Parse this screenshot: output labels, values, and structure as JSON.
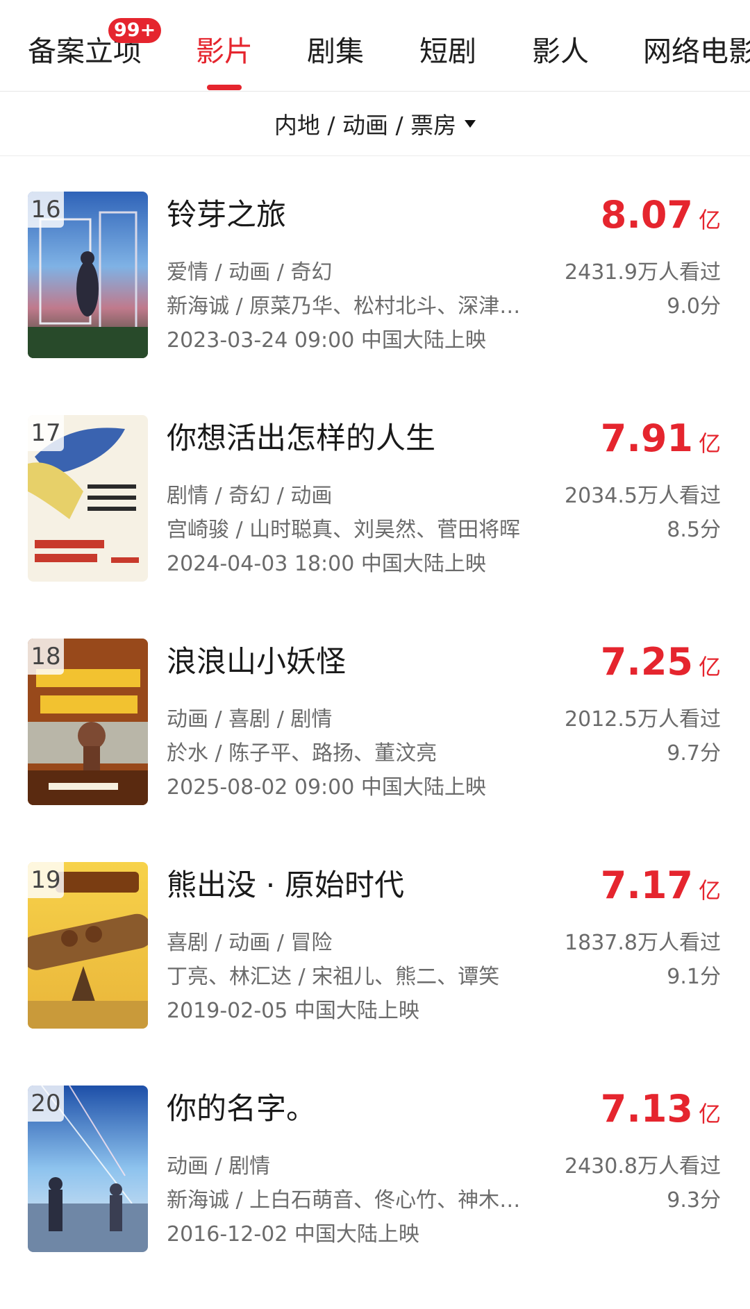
{
  "colors": {
    "accent": "#e5252e",
    "text_primary": "#1a1a1a",
    "text_secondary": "#6b6b6b"
  },
  "tabs": [
    {
      "label": "备案立项",
      "badge": "99+",
      "active": false
    },
    {
      "label": "影片",
      "active": true
    },
    {
      "label": "剧集",
      "active": false
    },
    {
      "label": "短剧",
      "active": false
    },
    {
      "label": "影人",
      "active": false
    },
    {
      "label": "网络电影",
      "active": false
    }
  ],
  "filter": {
    "label": "内地 / 动画 / 票房",
    "icon": "caret-down-icon"
  },
  "movies": [
    {
      "rank": "16",
      "title": "铃芽之旅",
      "box_office": "8.07",
      "unit": "亿",
      "genres": "爱情 / 动画 / 奇幻",
      "crew": "新海诚 / 原菜乃华、松村北斗、深津绘里",
      "release": "2023-03-24 09:00 中国大陆上映",
      "viewers": "2431.9万人看过",
      "score": "9.0分"
    },
    {
      "rank": "17",
      "title": "你想活出怎样的人生",
      "box_office": "7.91",
      "unit": "亿",
      "genres": "剧情 / 奇幻 / 动画",
      "crew": "宫崎骏 / 山时聪真、刘昊然、菅田将晖",
      "release": "2024-04-03 18:00 中国大陆上映",
      "viewers": "2034.5万人看过",
      "score": "8.5分"
    },
    {
      "rank": "18",
      "title": "浪浪山小妖怪",
      "box_office": "7.25",
      "unit": "亿",
      "genres": "动画 / 喜剧 / 剧情",
      "crew": "於水 / 陈子平、路扬、董汶亮",
      "release": "2025-08-02 09:00 中国大陆上映",
      "viewers": "2012.5万人看过",
      "score": "9.7分"
    },
    {
      "rank": "19",
      "title": "熊出没 · 原始时代",
      "box_office": "7.17",
      "unit": "亿",
      "genres": "喜剧 / 动画 / 冒险",
      "crew": "丁亮、林汇达 / 宋祖儿、熊二、谭笑",
      "release": "2019-02-05 中国大陆上映",
      "viewers": "1837.8万人看过",
      "score": "9.1分"
    },
    {
      "rank": "20",
      "title": "你的名字。",
      "box_office": "7.13",
      "unit": "亿",
      "genres": "动画 / 剧情",
      "crew": "新海诚 / 上白石萌音、佟心竹、神木隆之介",
      "release": "2016-12-02 中国大陆上映",
      "viewers": "2430.8万人看过",
      "score": "9.3分"
    }
  ]
}
